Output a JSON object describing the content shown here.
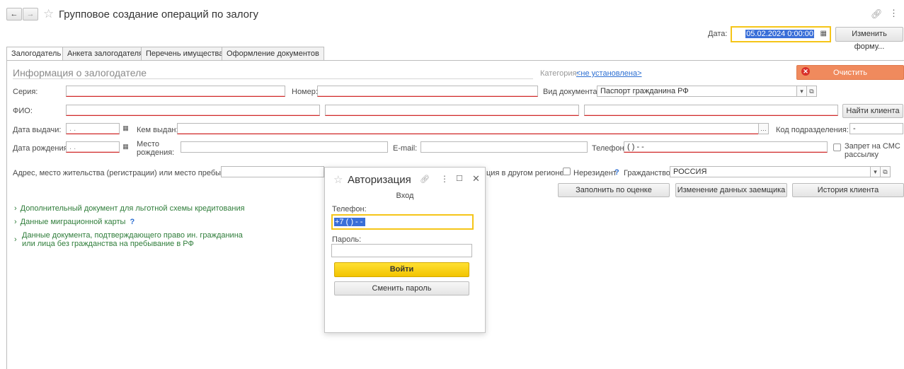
{
  "window": {
    "title": "Групповое создание операций по залогу",
    "nav_back": "←",
    "nav_forward": "→"
  },
  "header": {
    "date_label": "Дата:",
    "date_value": "05.02.2024  0:00:00",
    "change_form_button": "Изменить форму..."
  },
  "tabs": [
    "Залогодатель",
    "Анкета залогодателя",
    "Перечень имущества",
    "Оформление документов"
  ],
  "section": {
    "title": "Информация о залогодателе",
    "category_label": "Категория:",
    "category_value": "<не установлена>",
    "clear_button": "Очистить"
  },
  "form": {
    "series_label": "Серия:",
    "number_label": "Номер:",
    "doc_type_label": "Вид документа:",
    "doc_type_value": "Паспорт гражданина РФ",
    "fio_label": "ФИО:",
    "find_client_button": "Найти клиента",
    "issue_date_label": "Дата выдачи:",
    "issue_date_placeholder": " .  .",
    "issued_by_label": "Кем выдан:",
    "subdivision_label": "Код подразделения:",
    "subdivision_value": " -",
    "birth_date_label": "Дата рождения:",
    "birth_date_placeholder": " .  .",
    "birth_place_label": "Место рождения:",
    "email_label": "E-mail:",
    "phone_label": "Телефон:",
    "phone_value": "(   )   -  -",
    "sms_refuse_label": "Запрет на СМС рассылку",
    "address_label": "Адрес, место жительства (регистрации) или место пребывания:",
    "other_region_label": "ция в другом регионе",
    "nonresident_label": "Нерезидент",
    "question_mark": "?",
    "citizenship_label": "Гражданство:",
    "citizenship_value": "РОССИЯ",
    "fill_by_rating_button": "Заполнить по оценке",
    "change_borrower_button": "Изменение данных заемщика",
    "client_history_button": "История клиента"
  },
  "expanders": {
    "extra_doc": "Дополнительный документ для льготной схемы кредитования",
    "migration_card": "Данные миграционной карты",
    "foreign_doc_line1": "Данные документа, подтверждающего право ин. гражданина",
    "foreign_doc_line2": "или лица без гражданства на пребывание в РФ"
  },
  "dialog": {
    "title": "Авторизация",
    "subtitle": "Вход",
    "phone_label": "Телефон:",
    "phone_value": "+7 (   )   -  -",
    "password_label": "Пароль:",
    "login_button": "Войти",
    "change_password_button": "Сменить пароль"
  },
  "colors": {
    "accent_yellow": "#f5c518",
    "clear_orange": "#f08a5d",
    "link_green": "#2f7d3a",
    "link_blue": "#2b6ed2"
  }
}
